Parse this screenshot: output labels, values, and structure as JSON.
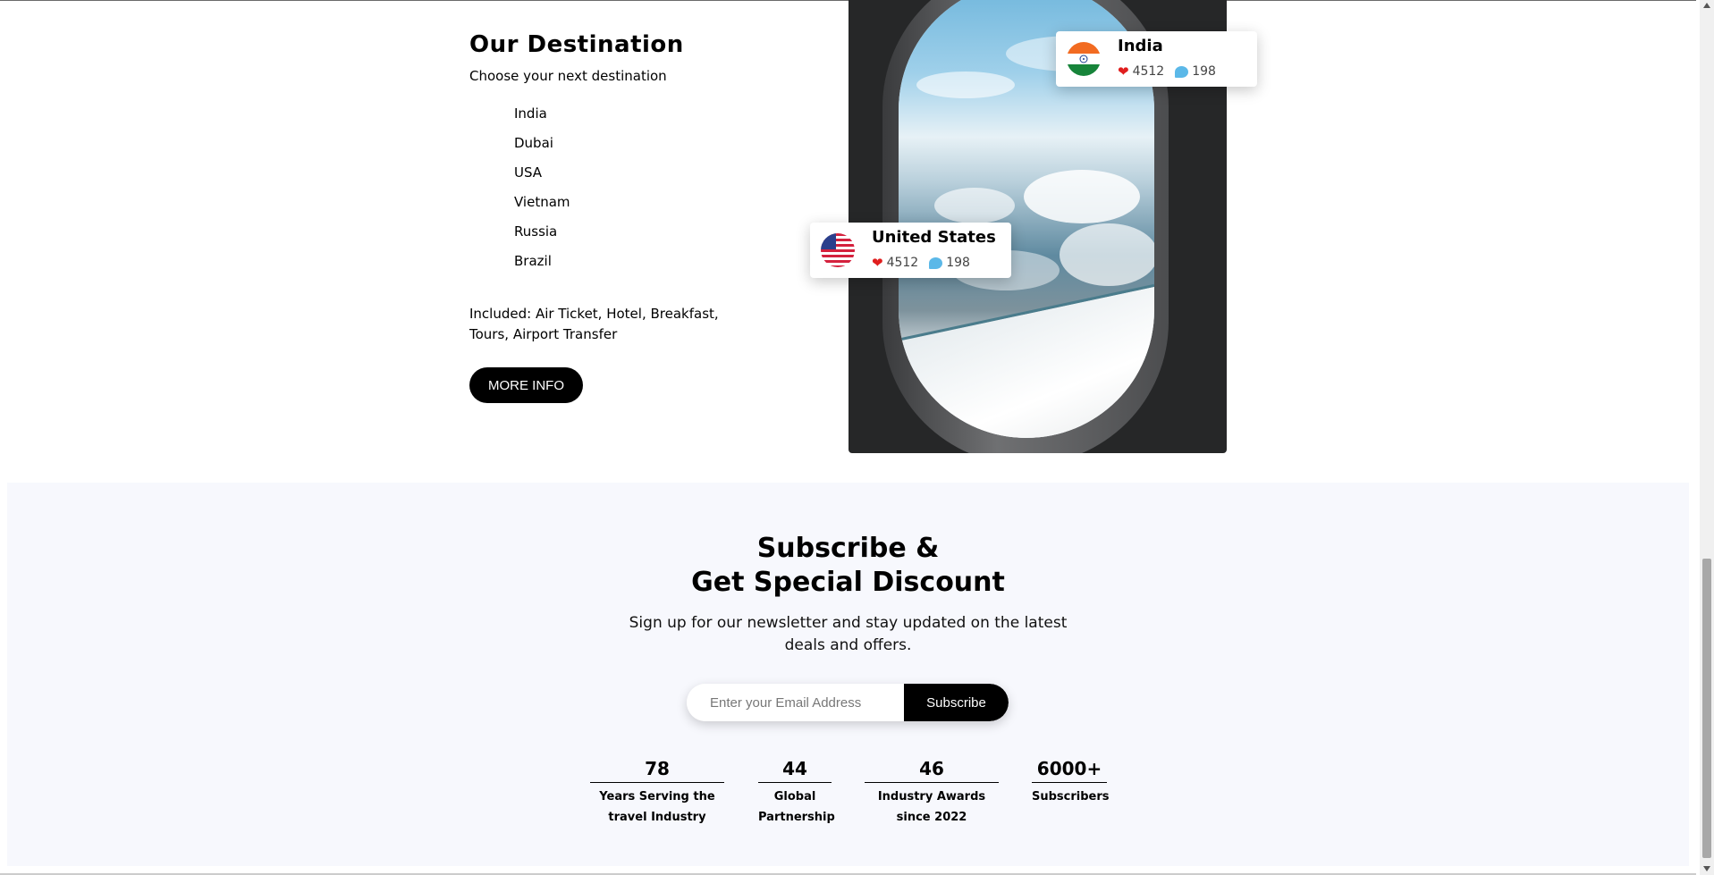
{
  "destination": {
    "title": "Our Destination",
    "subtitle": "Choose your next destination",
    "items": [
      "India",
      "Dubai",
      "USA",
      "Vietnam",
      "Russia",
      "Brazil"
    ],
    "included": "Included: Air Ticket, Hotel, Breakfast, Tours, Airport Transfer",
    "more_info_label": "MORE INFO"
  },
  "cards": {
    "india": {
      "name": "India",
      "likes": "4512",
      "comments": "198",
      "flag_icon": "india-flag-icon"
    },
    "us": {
      "name": "United States",
      "likes": "4512",
      "comments": "198",
      "flag_icon": "us-flag-icon"
    }
  },
  "subscribe": {
    "title_line1": "Subscribe &",
    "title_line2": "Get Special Discount",
    "description": "Sign up for our newsletter and stay updated on the latest deals and offers.",
    "email_placeholder": "Enter your Email Address",
    "button_label": "Subscribe"
  },
  "stats": [
    {
      "value": "78",
      "label": "Years Serving the travel Industry"
    },
    {
      "value": "44",
      "label": "Global Partnership"
    },
    {
      "value": "46",
      "label": "Industry Awards since 2022"
    },
    {
      "value": "6000+",
      "label": "Subscribers"
    }
  ],
  "colors": {
    "accent": "#000000",
    "heart": "#e01e1e",
    "comment": "#5bb8e8",
    "section_bg": "#f7f8fd"
  }
}
